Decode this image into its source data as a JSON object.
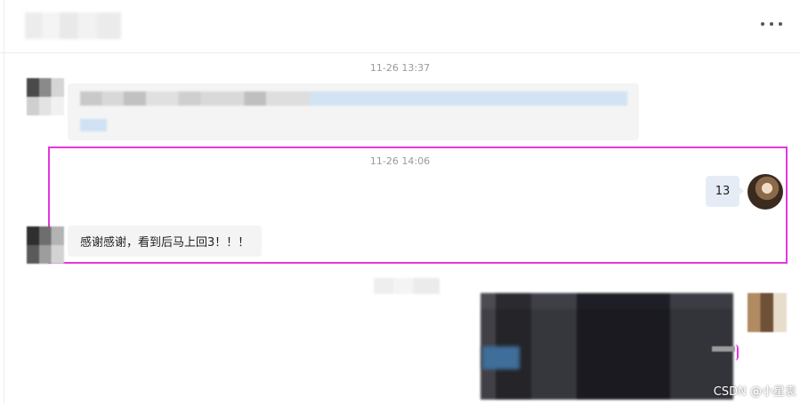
{
  "header": {
    "more_icon": "more-horizontal-icon"
  },
  "messages": {
    "timestamp_1": "11-26 13:37",
    "timestamp_2": "11-26 14:06",
    "self_message": "13",
    "reply_message": "感谢感谢，看到后马上回3！！！"
  },
  "watermark": "CSDN @小星袁",
  "colors": {
    "highlight_border": "#e436e0",
    "self_bubble": "#e6ecf6",
    "other_bubble": "#f4f4f5"
  }
}
